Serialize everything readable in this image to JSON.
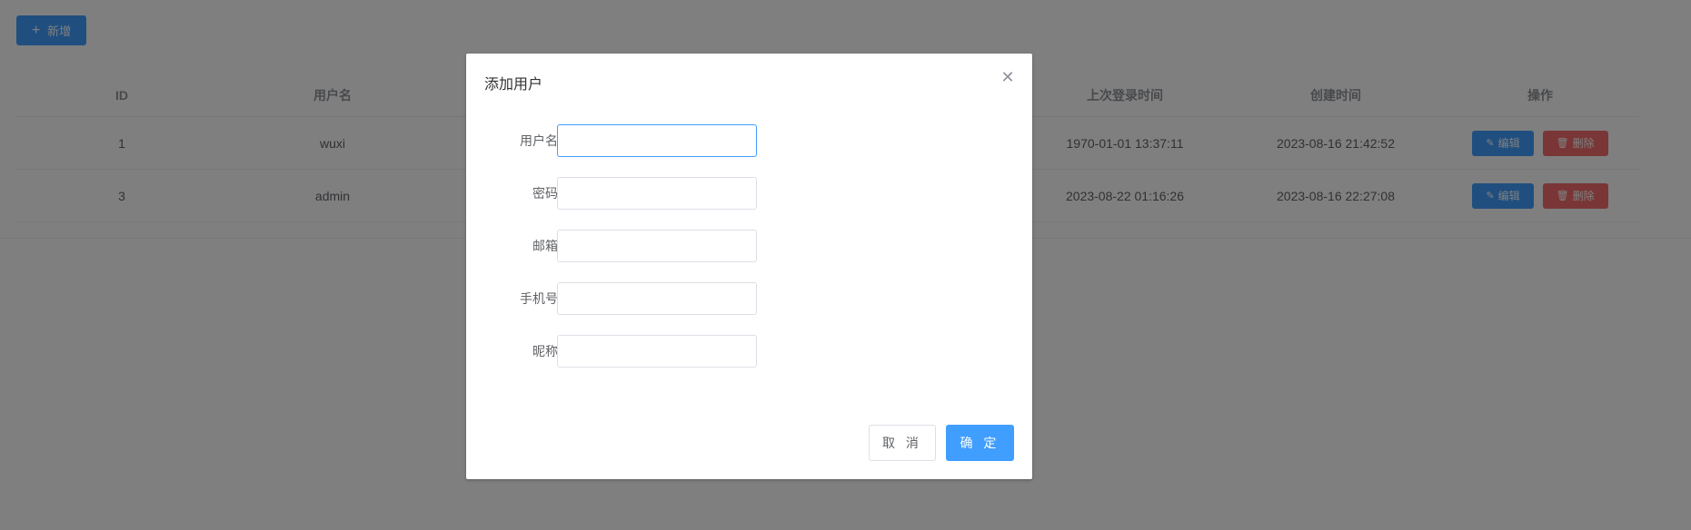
{
  "toolbar": {
    "add_label": "新增",
    "add_icon": "plus-icon"
  },
  "table": {
    "headers": {
      "id": "ID",
      "username": "用户名",
      "last_login": "上次登录时间",
      "created": "创建时间",
      "ops": "操作"
    },
    "rows": [
      {
        "id": "1",
        "username": "wuxi",
        "last_login": "1970-01-01 13:37:11",
        "created": "2023-08-16 21:42:52",
        "edit": "编辑",
        "delete": "删除"
      },
      {
        "id": "3",
        "username": "admin",
        "last_login": "2023-08-22 01:16:26",
        "created": "2023-08-16 22:27:08",
        "edit": "编辑",
        "delete": "删除"
      }
    ]
  },
  "dialog": {
    "title": "添加用户",
    "fields": {
      "username": {
        "label": "用户名",
        "value": ""
      },
      "password": {
        "label": "密码",
        "value": ""
      },
      "email": {
        "label": "邮箱",
        "value": ""
      },
      "phone": {
        "label": "手机号",
        "value": ""
      },
      "nickname": {
        "label": "昵称",
        "value": ""
      }
    },
    "cancel_label": "取 消",
    "ok_label": "确 定"
  },
  "colors": {
    "primary": "#409eff",
    "danger": "#f56c6c"
  }
}
